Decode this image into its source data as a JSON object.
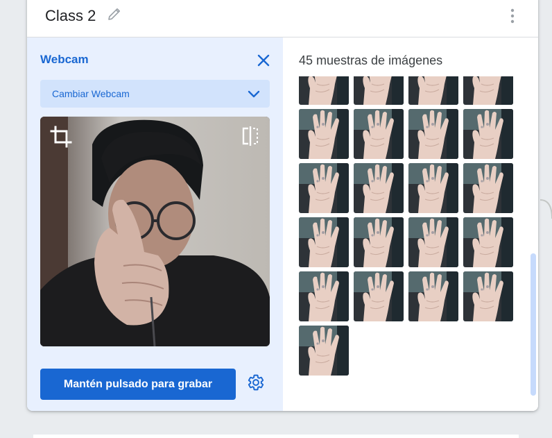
{
  "card": {
    "title": "Class 2",
    "edit_icon": "pencil-icon",
    "menu_icon": "more-vert-icon"
  },
  "webcam": {
    "label": "Webcam",
    "close_icon": "close-icon",
    "select": {
      "label": "Cambiar Webcam",
      "icon": "chevron-down-icon"
    },
    "preview_icons": [
      "crop-icon",
      "flip-icon"
    ],
    "record_label": "Mantén pulsado para grabar",
    "settings_icon": "gear-icon"
  },
  "samples": {
    "count_label": "45 muestras de imágenes",
    "visible_thumbnails": 21
  },
  "colors": {
    "accent": "#1967d2",
    "panel_bg": "#e8f0fe",
    "select_bg": "#d2e3fc",
    "scrollbar": "#c6dafc"
  }
}
